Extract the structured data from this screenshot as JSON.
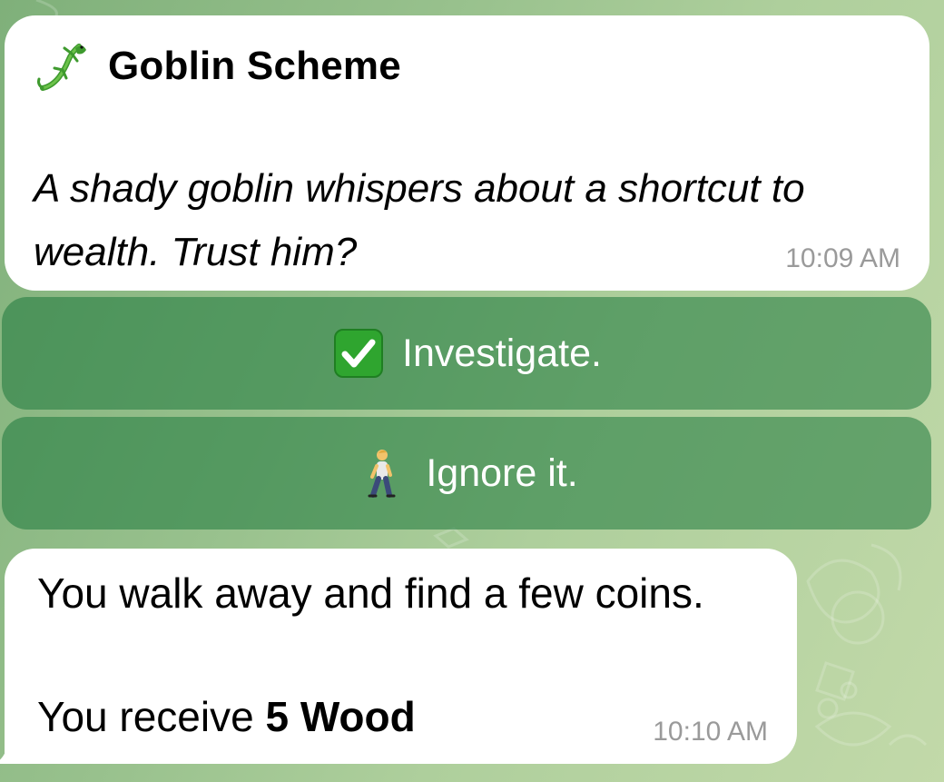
{
  "message1": {
    "icon": "lizard-icon",
    "title": "Goblin Scheme",
    "body": "A shady goblin whispers about a shortcut to wealth. Trust him?",
    "time": "10:09 AM"
  },
  "buttons": [
    {
      "icon": "check-mark-icon",
      "label": "Investigate."
    },
    {
      "icon": "walking-person-icon",
      "label": "Ignore it."
    }
  ],
  "message2": {
    "line1": "You walk away and find a few coins.",
    "line2_prefix": "You receive ",
    "line2_bold": "5 Wood",
    "time": "10:10 AM"
  },
  "colors": {
    "button_bg": "#3f8a52",
    "bubble_bg": "#ffffff",
    "timestamp": "#9a9a9a",
    "check_green": "#2fa52f"
  }
}
